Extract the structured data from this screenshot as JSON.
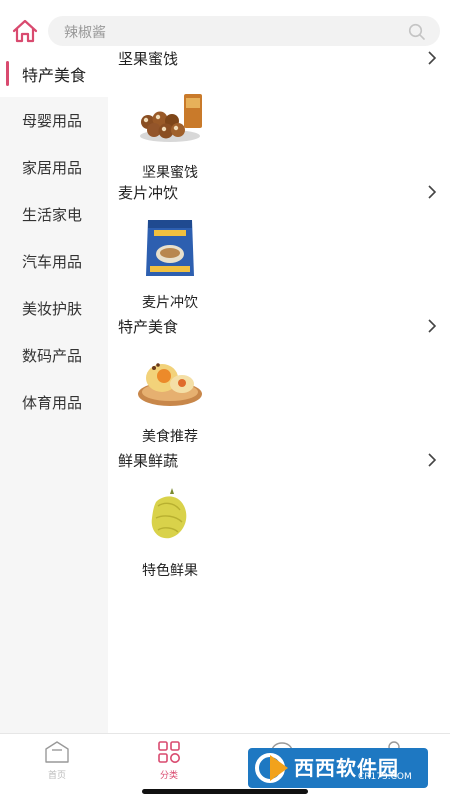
{
  "search": {
    "placeholder": "辣椒酱"
  },
  "sidebar": {
    "items": [
      {
        "label": "特产美食",
        "active": true
      },
      {
        "label": "母婴用品"
      },
      {
        "label": "家居用品"
      },
      {
        "label": "生活家电"
      },
      {
        "label": "汽车用品"
      },
      {
        "label": "美妆护肤"
      },
      {
        "label": "数码产品"
      },
      {
        "label": "体育用品"
      }
    ]
  },
  "sections": [
    {
      "title": "坚果蜜饯",
      "product": {
        "name": "坚果蜜饯",
        "icon": "nuts-image"
      }
    },
    {
      "title": "麦片冲饮",
      "product": {
        "name": "麦片冲饮",
        "icon": "oatmeal-image"
      }
    },
    {
      "title": "特产美食",
      "product": {
        "name": "美食推荐",
        "icon": "pastry-image"
      }
    },
    {
      "title": "鲜果鲜蔬",
      "product": {
        "name": "特色鲜果",
        "icon": "durian-image"
      }
    }
  ],
  "tabbar": {
    "tabs": [
      {
        "label": "首页"
      },
      {
        "label": "分类",
        "active": true
      },
      {
        "label": ""
      },
      {
        "label": ""
      }
    ]
  },
  "watermark": {
    "text": "西西软件园",
    "url": "CR173.COM"
  },
  "colors": {
    "accent": "#d94a6f",
    "sidebar_bg": "#f6f6f6",
    "watermark_bg": "#1e78c2"
  }
}
